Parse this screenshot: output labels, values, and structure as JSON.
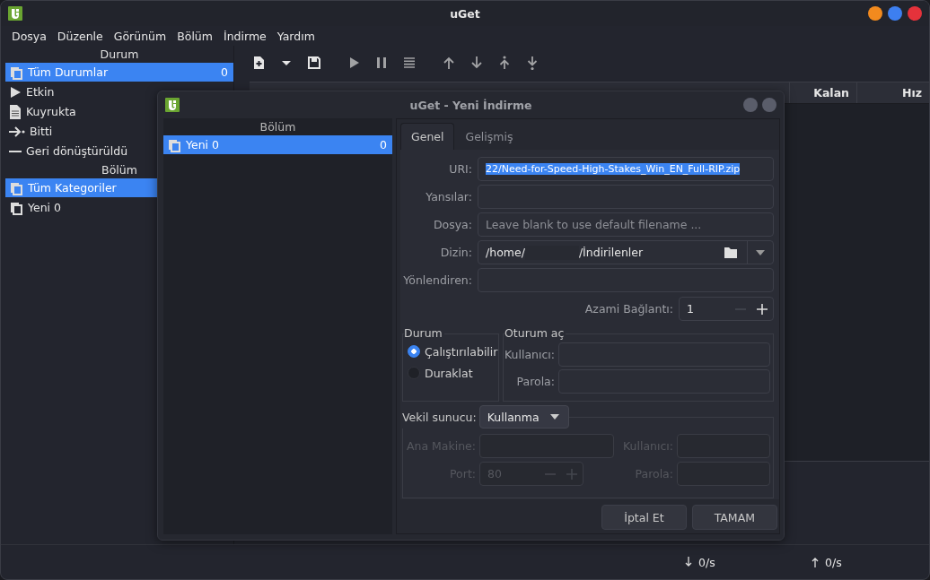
{
  "window": {
    "title": "uGet",
    "controls": [
      {
        "color": "#f28a1e"
      },
      {
        "color": "#3d7ff0"
      },
      {
        "color": "#e5323b"
      }
    ]
  },
  "menu": [
    "Dosya",
    "Düzenle",
    "Görünüm",
    "Bölüm",
    "İndirme",
    "Yardım"
  ],
  "sidebar": {
    "status_header": "Durum",
    "status_items": [
      {
        "label": "Tüm Durumlar",
        "count": "0",
        "kind": "copies",
        "selected": true
      },
      {
        "label": "Etkin",
        "kind": "play",
        "selected": false
      },
      {
        "label": "Kuyrukta",
        "kind": "document",
        "selected": false
      },
      {
        "label": "Bitti",
        "kind": "finish",
        "selected": false
      },
      {
        "label": "Geri dönüştürüldü",
        "kind": "dash",
        "selected": false
      }
    ],
    "category_header": "Bölüm",
    "category_items": [
      {
        "label": "Tüm Kategoriler",
        "kind": "copies",
        "selected": true
      },
      {
        "label": "Yeni 0",
        "kind": "copies",
        "selected": false
      }
    ]
  },
  "toolbar": [
    {
      "kind": "new",
      "disabled": false
    },
    {
      "kind": "dropdown",
      "disabled": false
    },
    {
      "kind": "save",
      "disabled": false
    },
    {
      "kind": "play",
      "disabled": true
    },
    {
      "kind": "pause",
      "disabled": true
    },
    {
      "kind": "list",
      "disabled": true
    },
    {
      "kind": "up",
      "disabled": true
    },
    {
      "kind": "down",
      "disabled": true
    },
    {
      "kind": "top",
      "disabled": true
    },
    {
      "kind": "bottom",
      "disabled": true
    }
  ],
  "table": {
    "columns": [
      "Kalan",
      "Hız"
    ]
  },
  "status_bar": {
    "download": "0/s",
    "upload": "0/s"
  },
  "dialog": {
    "title": "uGet - Yeni İndirme",
    "category_header": "Bölüm",
    "categories": [
      {
        "label": "Yeni 0",
        "count": "0",
        "selected": true
      }
    ],
    "tabs": [
      {
        "label": "Genel",
        "selected": true
      },
      {
        "label": "Gelişmiş",
        "selected": false
      }
    ],
    "fields": [
      {
        "label": "URI:",
        "kind": "text",
        "value": "22/Need-for-Speed-High-Stakes_Win_EN_Full-RIP.zip",
        "highlighted": true
      },
      {
        "label": "Yansılar:",
        "kind": "text"
      },
      {
        "label": "Dosya:",
        "kind": "text",
        "placeholder": "Leave blank to use default filename ..."
      },
      {
        "label": "Dizin:",
        "kind": "folder",
        "value_start": "/home/",
        "value_end": "/İndirilenler"
      },
      {
        "label": "Yönlendiren:",
        "kind": "text"
      }
    ],
    "connections": {
      "label": "Azami Bağlantı:",
      "value": "1"
    },
    "state_group": {
      "title": "Durum",
      "options": [
        {
          "label": "Çalıştırılabilir",
          "selected": true
        },
        {
          "label": "Duraklat",
          "selected": false
        }
      ]
    },
    "login_group": {
      "title": "Oturum aç",
      "fields": [
        {
          "label": "Kullanıcı:"
        },
        {
          "label": "Parola:"
        }
      ]
    },
    "proxy": {
      "label": "Vekil sunucu:",
      "type": "Kullanma",
      "disabled": true,
      "host_label": "Ana Makine:",
      "user_label": "Kullanıcı:",
      "port_label": "Port:",
      "port": "80",
      "password_label": "Parola:"
    },
    "buttons": [
      "İptal Et",
      "TAMAM"
    ]
  }
}
